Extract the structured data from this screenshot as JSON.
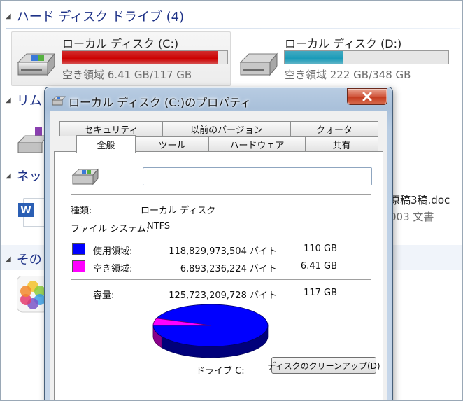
{
  "explorer": {
    "hdd_group": {
      "title": "ハード ディスク ドライブ (4)"
    },
    "removable_group": {
      "title": "リム"
    },
    "network_group": {
      "title": "ネッ"
    },
    "other_group": {
      "title": "その"
    },
    "drives": [
      {
        "name": "ローカル ディスク (C:)",
        "free": "空き領域 6.41 GB/117 GB",
        "used_fraction": 0.945,
        "bar_color": "#cc0000"
      },
      {
        "name": "ローカル ディスク (D:)",
        "free": "空き領域 222 GB/348 GB",
        "used_fraction": 0.36,
        "bar_color": "#1a9bb8"
      }
    ],
    "partial_items": [
      {
        "text": ")"
      },
      {
        "text": "原稿3稿.doc"
      },
      {
        "text": "003 文書"
      }
    ]
  },
  "dialog": {
    "title": "ローカル ディスク (C:)のプロパティ",
    "tabs_row1": [
      "セキュリティ",
      "以前のバージョン",
      "クォータ"
    ],
    "tabs_row2": [
      "全般",
      "ツール",
      "ハードウェア",
      "共有"
    ],
    "active_tab": "全般",
    "volume_label_value": "",
    "type_label": "種類:",
    "type_value": "ローカル ディスク",
    "fs_label": "ファイル システム:",
    "fs_value": "NTFS",
    "used": {
      "label": "使用領域:",
      "bytes": "118,829,973,504 バイト",
      "size": "110 GB",
      "color": "#0000ff"
    },
    "free": {
      "label": "空き領域:",
      "bytes": "6,893,236,224 バイト",
      "size": "6.41 GB",
      "color": "#ff00ff"
    },
    "capacity": {
      "label": "容量:",
      "bytes": "125,723,209,728 バイト",
      "size": "117 GB"
    },
    "pie": {
      "used_fraction": 0.9452,
      "free_fraction": 0.0548
    },
    "drive_label": "ドライブ C:",
    "cleanup_button": "ディスクのクリーンアップ(D)"
  }
}
